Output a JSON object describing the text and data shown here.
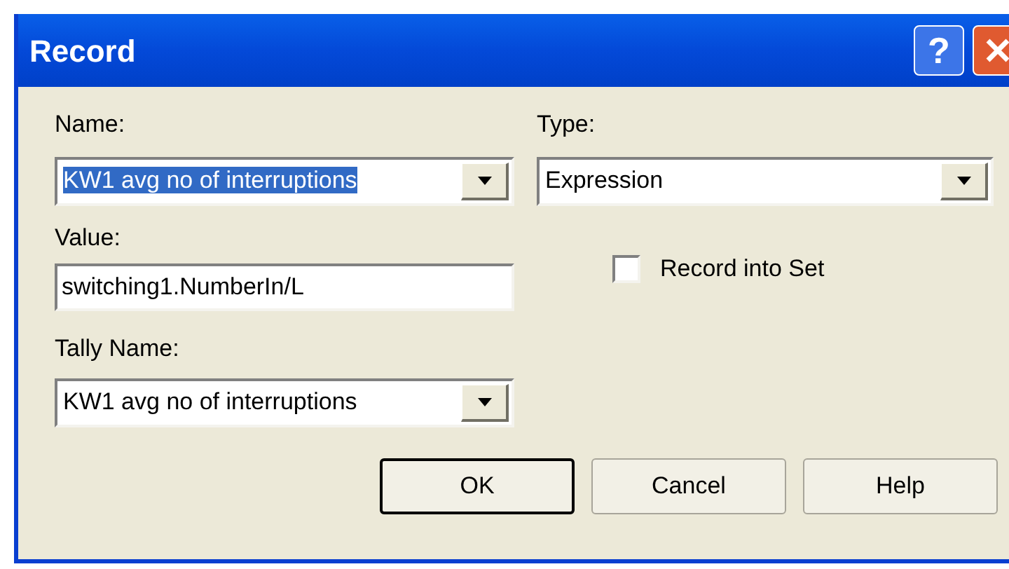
{
  "window": {
    "title": "Record",
    "controls": [
      {
        "kind": "help",
        "label": "?"
      },
      {
        "kind": "close"
      }
    ]
  },
  "name": {
    "label": "Name:",
    "value": "KW1 avg no of interruptions",
    "text_selected": true
  },
  "type": {
    "label": "Type:",
    "value": "Expression"
  },
  "value": {
    "label": "Value:",
    "value": "switching1.NumberIn/L"
  },
  "record_into_set": {
    "label": "Record into Set",
    "checked": false
  },
  "tally_name": {
    "label": "Tally Name:",
    "value": "KW1 avg no of interruptions"
  },
  "buttons": [
    {
      "label": "OK",
      "default": true
    },
    {
      "label": "Cancel",
      "default": false
    },
    {
      "label": "Help",
      "default": false
    }
  ]
}
